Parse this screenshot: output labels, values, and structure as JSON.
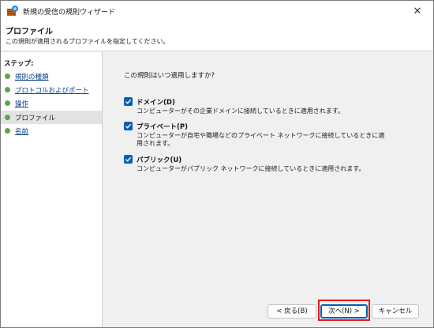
{
  "window": {
    "title": "新規の受信の規則ウィザード",
    "close_label": "✕"
  },
  "header": {
    "title": "プロファイル",
    "subtitle": "この規則が適用されるプロファイルを指定してください。"
  },
  "sidebar": {
    "steps_label": "ステップ:",
    "items": [
      {
        "label": "規則の種類",
        "state": "link"
      },
      {
        "label": "プロトコルおよびポート",
        "state": "link"
      },
      {
        "label": "操作",
        "state": "link"
      },
      {
        "label": "プロファイル",
        "state": "current"
      },
      {
        "label": "名前",
        "state": "link"
      }
    ]
  },
  "main": {
    "question": "この規則はいつ適用しますか?",
    "options": [
      {
        "title": "ドメイン(D)",
        "description": "コンピューターがその企業ドメインに接続しているときに適用されます。",
        "checked": true
      },
      {
        "title": "プライベート(P)",
        "description": "コンピューターが自宅や職場などのプライベート ネットワークに接続しているときに適用されます。",
        "checked": true
      },
      {
        "title": "パブリック(U)",
        "description": "コンピューターがパブリック ネットワークに接続しているときに適用されます。",
        "checked": true
      }
    ]
  },
  "buttons": {
    "back": "< 戻る(B)",
    "next": "次へ(N) >",
    "cancel": "キャンセル"
  },
  "colors": {
    "accent": "#005fb8",
    "step_dot": "#5aa64a",
    "highlight": "#e21a1a"
  }
}
